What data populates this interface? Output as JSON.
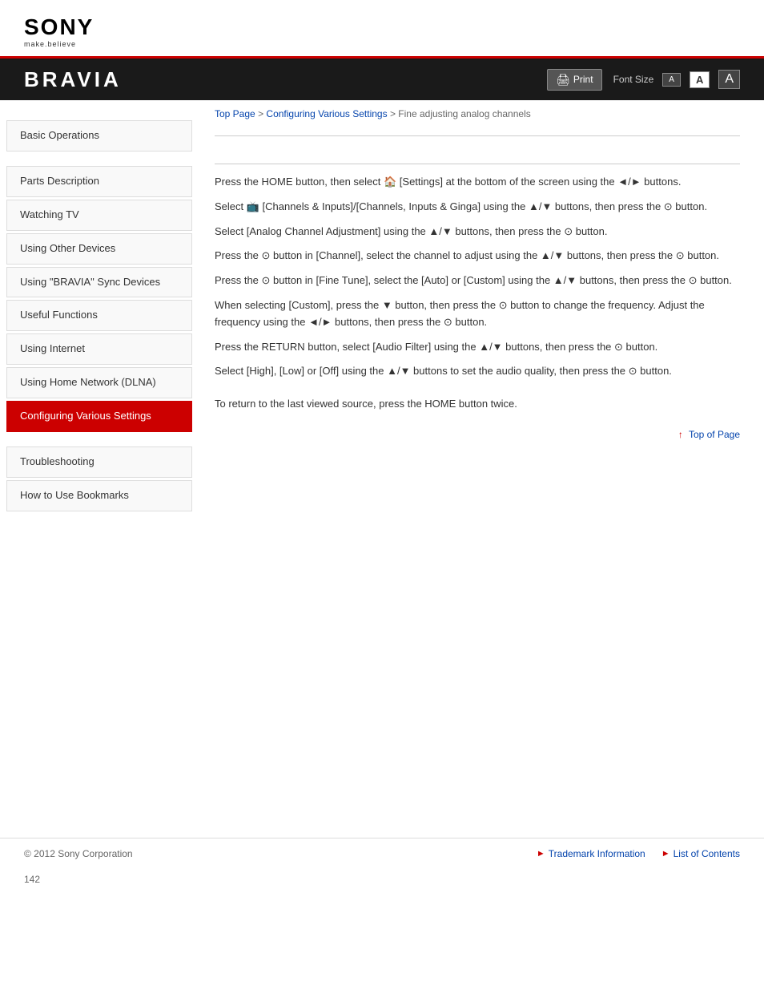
{
  "header": {
    "sony_text": "SONY",
    "sony_tagline": "make.believe",
    "bravia_title": "BRAVIA",
    "print_label": "Print",
    "font_size_label": "Font Size",
    "font_sizes": [
      "A",
      "A",
      "A"
    ]
  },
  "breadcrumb": {
    "top_page": "Top Page",
    "configuring": "Configuring Various Settings",
    "current": "Fine adjusting analog channels"
  },
  "sidebar": {
    "items": [
      {
        "id": "basic-operations",
        "label": "Basic Operations",
        "active": false
      },
      {
        "id": "parts-description",
        "label": "Parts Description",
        "active": false
      },
      {
        "id": "watching-tv",
        "label": "Watching TV",
        "active": false
      },
      {
        "id": "using-other-devices",
        "label": "Using Other Devices",
        "active": false
      },
      {
        "id": "using-bravia-sync",
        "label": "Using \"BRAVIA\" Sync Devices",
        "active": false
      },
      {
        "id": "useful-functions",
        "label": "Useful Functions",
        "active": false
      },
      {
        "id": "using-internet",
        "label": "Using Internet",
        "active": false
      },
      {
        "id": "using-home-network",
        "label": "Using Home Network (DLNA)",
        "active": false
      },
      {
        "id": "configuring-various-settings",
        "label": "Configuring Various Settings",
        "active": true
      },
      {
        "id": "troubleshooting",
        "label": "Troubleshooting",
        "active": false
      },
      {
        "id": "how-to-use-bookmarks",
        "label": "How to Use Bookmarks",
        "active": false
      }
    ]
  },
  "content": {
    "steps": [
      "Press the HOME button, then select 🏠 [Settings] at the bottom of the screen using the ◄/► buttons.",
      "Select 📺 [Channels & Inputs]/[Channels, Inputs & Ginga] using the ▲/▼ buttons, then press the ⊙ button.",
      "Select [Analog Channel Adjustment] using the ▲/▼ buttons, then press the ⊙ button.",
      "Press the ⊙ button in [Channel], select the channel to adjust using the ▲/▼ buttons, then press the ⊙ button.",
      "Press the ⊙ button in [Fine Tune], select the [Auto] or [Custom] using the ▲/▼ buttons, then press the ⊙ button.",
      "When selecting [Custom], press the ▼ button, then press the ⊙ button to change the frequency. Adjust the frequency using the ◄/► buttons, then press the ⊙ button.",
      "Press the RETURN button, select [Audio Filter] using the ▲/▼ buttons, then press the ⊙ button.",
      "Select [High], [Low] or [Off] using the ▲/▼ buttons to set the audio quality, then press the ⊙ button."
    ],
    "return_note": "To return to the last viewed source, press the HOME button twice.",
    "top_of_page": "Top of Page"
  },
  "footer": {
    "copyright": "© 2012 Sony Corporation",
    "trademark": "Trademark Information",
    "list_of_contents": "List of Contents"
  },
  "page_number": "142"
}
